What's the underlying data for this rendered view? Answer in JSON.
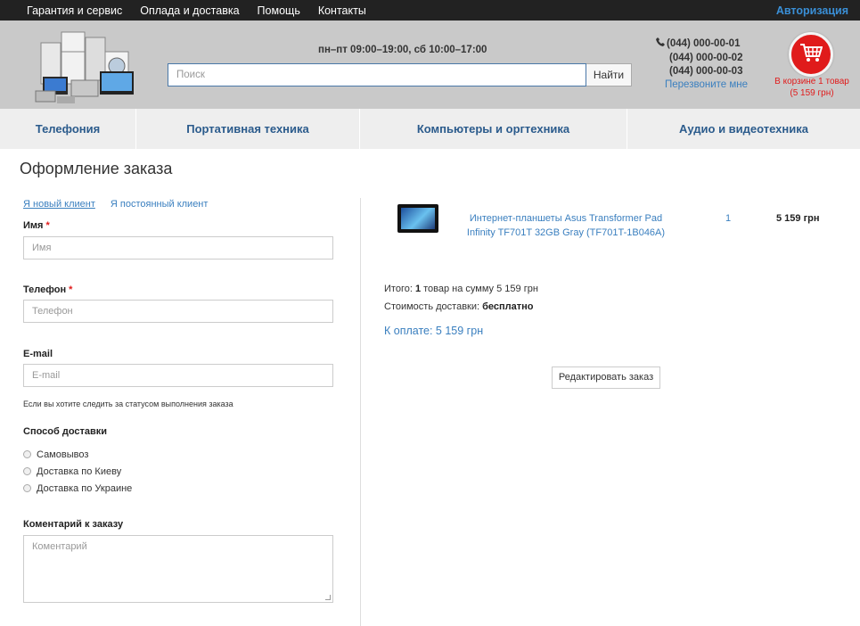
{
  "topbar": {
    "menu": [
      "Гарантия и сервис",
      "Оплада и доставка",
      "Помощь",
      "Контакты"
    ],
    "auth": "Авторизация"
  },
  "header": {
    "hours": "пн–пт 09:00–19:00, сб 10:00–17:00",
    "search_placeholder": "Поиск",
    "search_button": "Найти",
    "phones": [
      "(044) 000-00-01",
      "(044) 000-00-02",
      "(044) 000-00-03"
    ],
    "callback": "Перезвоните мне",
    "cart_line1": "В корзине 1 товар",
    "cart_line2": "(5 159 грн)"
  },
  "nav": [
    "Телефония",
    "Портативная техника",
    "Компьютеры и оргтехника",
    "Аудио и видеотехника"
  ],
  "page_title": "Оформление заказа",
  "form": {
    "tab_new": "Я новый клиент",
    "tab_existing": "Я постоянный клиент",
    "name_label": "Имя",
    "name_placeholder": "Имя",
    "phone_label": "Телефон",
    "phone_placeholder": "Телефон",
    "required_mark": "*",
    "email_label": "E-mail",
    "email_placeholder": "E-mail",
    "email_hint": "Если вы хотите следить за статусом выполнения заказа",
    "delivery_label": "Способ доставки",
    "delivery_options": [
      "Самовывоз",
      "Доставка по Киеву",
      "Доставка по Украине"
    ],
    "comment_label": "Коментарий к заказу",
    "comment_placeholder": "Коментарий"
  },
  "order": {
    "product_name": "Интернет-планшеты Asus Transformer Pad Infinity TF701T 32GB Gray (TF701T-1B046A)",
    "qty": "1",
    "price": "5 159 грн",
    "total_prefix": "Итого:",
    "total_count": "1",
    "total_middle": "товар на сумму",
    "total_sum": "5 159 грн",
    "delivery_prefix": "Стоимость доставки:",
    "delivery_value": "бесплатно",
    "to_pay": "К оплате: 5 159 грн",
    "edit_button": "Редактировать заказ"
  }
}
